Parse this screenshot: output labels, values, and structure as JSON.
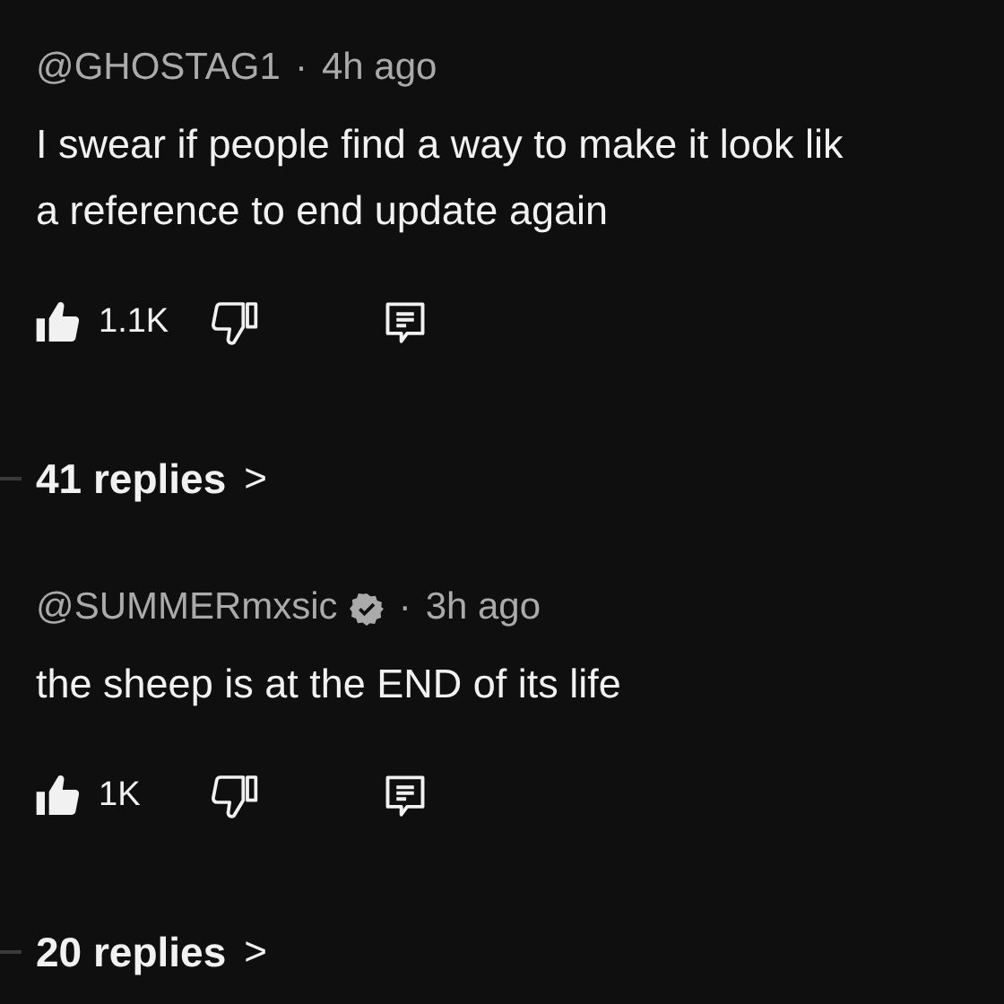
{
  "comments": [
    {
      "author": "@GHOSTAG1",
      "verified": false,
      "separator": "·",
      "time": "4h ago",
      "lines": [
        "I swear if people find a way to make it look lik",
        "a reference to end update again"
      ],
      "liked": true,
      "disliked": false,
      "likes": "1.1K",
      "replies": "41 replies",
      "replies_arrow": ">"
    },
    {
      "author": "@SUMMERmxsic",
      "verified": true,
      "separator": "·",
      "time": "3h ago",
      "lines": [
        "the sheep is at the END of its life"
      ],
      "liked": true,
      "disliked": false,
      "likes": "1K",
      "replies": "20 replies",
      "replies_arrow": ">"
    }
  ]
}
